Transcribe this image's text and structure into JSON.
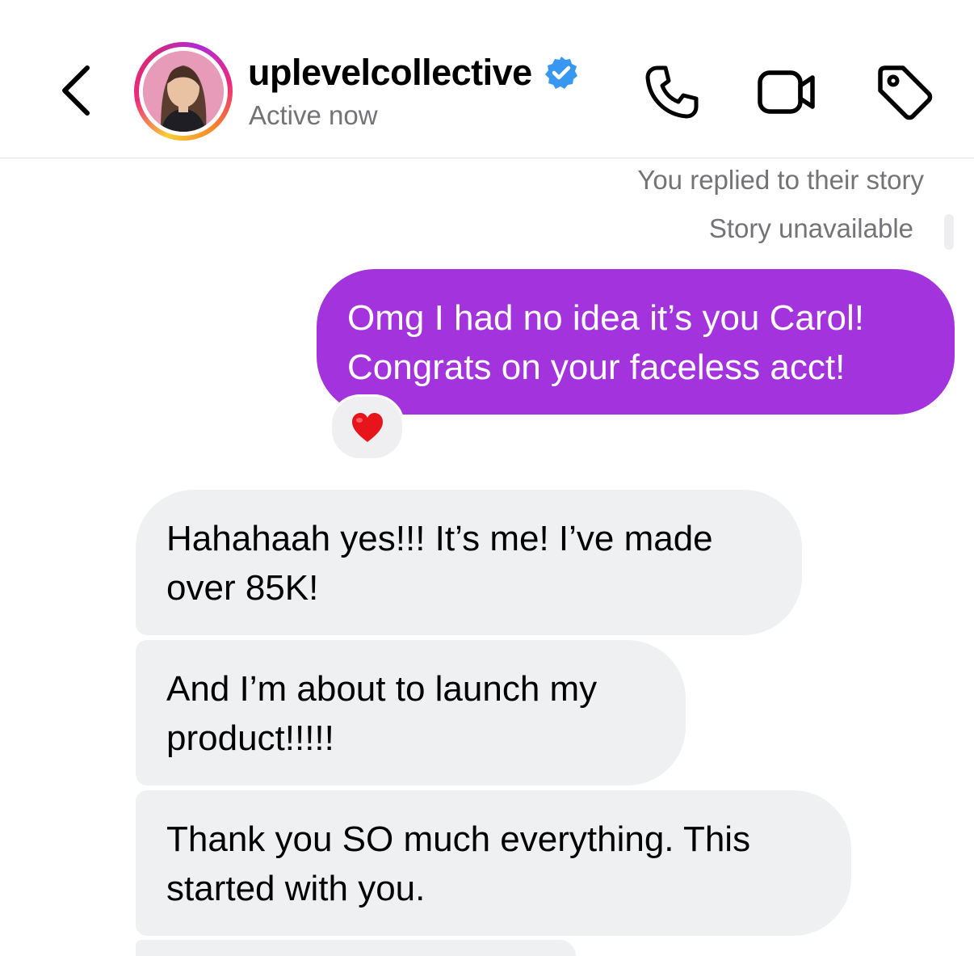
{
  "header": {
    "username": "uplevelcollective",
    "verified": true,
    "status": "Active now",
    "icons": [
      "back-chevron-icon",
      "phone-icon",
      "video-camera-icon",
      "tag-icon",
      "verified-badge-icon"
    ]
  },
  "thread": {
    "meta_replied": "You replied to their story",
    "meta_story": "Story unavailable",
    "messages": [
      {
        "sender": "me",
        "lines": [
          "Omg I had no idea it’s you Carol!",
          "Congrats on your faceless acct!"
        ],
        "reaction": "❤️"
      },
      {
        "sender": "them",
        "lines": [
          "Hahahaah yes!!! It’s me! I’ve made",
          "over 85K!"
        ]
      },
      {
        "sender": "them",
        "lines": [
          "And I’m about to launch my",
          "product!!!!!"
        ]
      },
      {
        "sender": "them",
        "lines": [
          "Thank you SO much everything. This",
          "started with you."
        ]
      }
    ]
  },
  "colors": {
    "outgoing_bubble": "#a334dd",
    "incoming_bubble": "#eff0f2",
    "secondary_text": "#737378",
    "verified_blue": "#3897f0"
  }
}
